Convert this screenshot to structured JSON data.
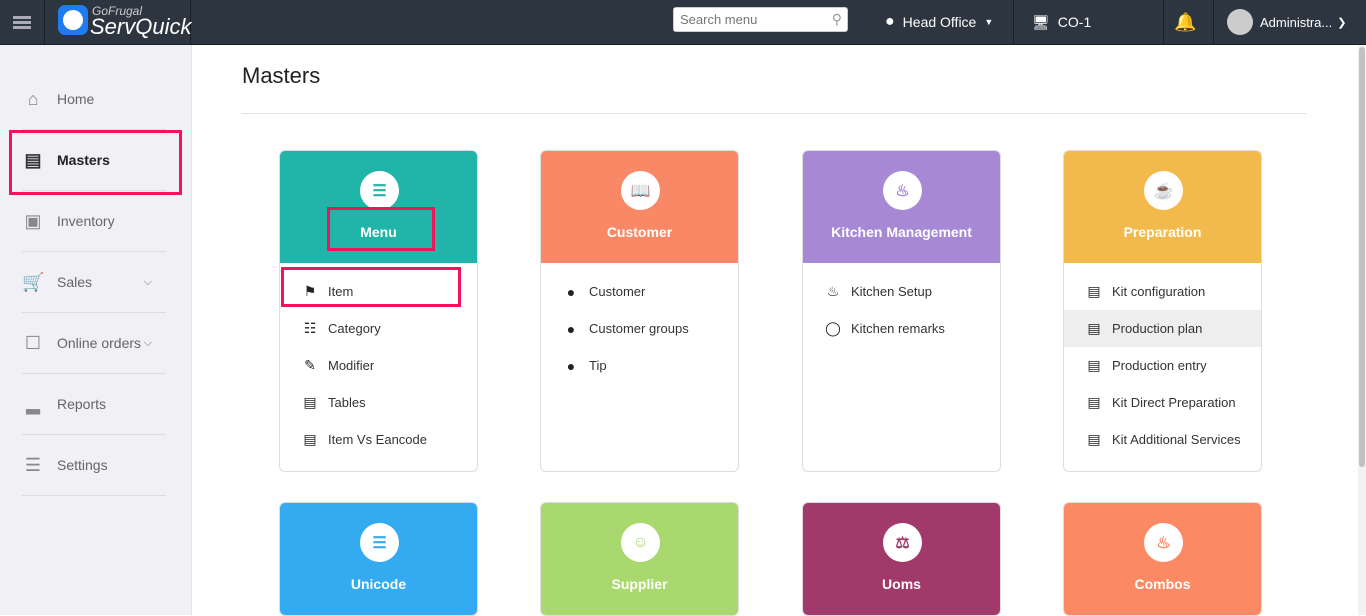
{
  "header": {
    "logo_top": "GoFrugal",
    "logo_main": "ServQuick",
    "search_placeholder": "Search menu",
    "location": "Head Office",
    "counter": "CO-1",
    "user": "Administra..."
  },
  "sidebar": {
    "items": [
      {
        "label": "Home"
      },
      {
        "label": "Masters"
      },
      {
        "label": "Inventory"
      },
      {
        "label": "Sales"
      },
      {
        "label": "Online orders"
      },
      {
        "label": "Reports"
      },
      {
        "label": "Settings"
      }
    ]
  },
  "page": {
    "title": "Masters"
  },
  "colors": {
    "menu": "#20b5a8",
    "customer": "#f98866",
    "kitchen": "#a688d4",
    "preparation": "#f2ba4c",
    "unicode": "#34abf0",
    "supplier": "#a9d86e",
    "uoms": "#a1396a",
    "combos": "#fb8a64",
    "highlight": "#f0145a"
  },
  "cards": [
    {
      "title": "Menu",
      "items": [
        "Item",
        "Category",
        "Modifier",
        "Tables",
        "Item Vs Eancode"
      ]
    },
    {
      "title": "Customer",
      "items": [
        "Customer",
        "Customer groups",
        "Tip"
      ]
    },
    {
      "title": "Kitchen Management",
      "items": [
        "Kitchen Setup",
        "Kitchen remarks"
      ]
    },
    {
      "title": "Preparation",
      "items": [
        "Kit configuration",
        "Production plan",
        "Production entry",
        "Kit Direct Preparation",
        "Kit Additional Services"
      ]
    },
    {
      "title": "Unicode"
    },
    {
      "title": "Supplier"
    },
    {
      "title": "Uoms"
    },
    {
      "title": "Combos"
    }
  ]
}
